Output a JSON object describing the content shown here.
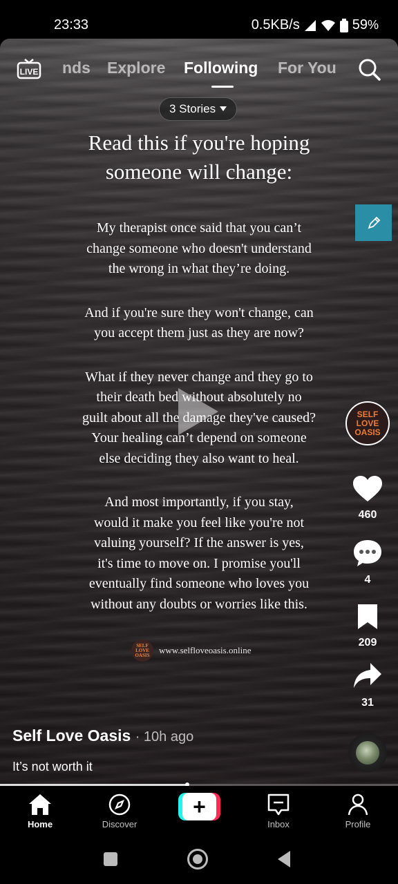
{
  "status": {
    "time": "23:33",
    "net": "0.5KB/s",
    "battery": "59"
  },
  "topnav": {
    "live": "LIVE",
    "tabs": [
      "nds",
      "Explore",
      "Following",
      "For You"
    ],
    "active_tab": "Following"
  },
  "stories_label": "3 Stories",
  "post": {
    "title_lines": [
      "Read this if you're hoping",
      "someone will change:"
    ],
    "paragraphs": [
      [
        "My therapist once said that you can’t",
        "change someone who doesn't understand",
        "the wrong in what they’re doing."
      ],
      [
        "And if you're sure they won't change, can",
        "you accept them just as they are now?"
      ],
      [
        "What if they never change and they go to",
        "their death bed without absolutely no",
        "guilt about all the damage they've caused?",
        "Your healing can’t depend on someone",
        "else deciding they also want to heal."
      ],
      [
        "And most importantly, if you stay,",
        "would it make you feel like you're not",
        "valuing yourself? If the answer is yes,",
        "it's time to move on. I promise you'll",
        "eventually find someone who loves you",
        "without any doubts or worries like this."
      ]
    ],
    "watermark_logo": "SELF LOVE OASIS",
    "watermark_url": "www.selfloveoasis.online"
  },
  "rail": {
    "avatar_text": [
      "SELF",
      "LOVE",
      "OASIS"
    ],
    "likes": "460",
    "comments": "4",
    "saves": "209",
    "shares": "31"
  },
  "caption": {
    "author": "Self Love Oasis",
    "ago": "· 10h ago",
    "description": "It’s not worth it"
  },
  "progress": 0.47,
  "bottomnav": {
    "home": "Home",
    "discover": "Discover",
    "plus": "+",
    "inbox": "Inbox",
    "profile": "Profile"
  },
  "colors": {
    "edit_button": "#2a8fa6",
    "avatar_text": "#ee7d35",
    "plus_left": "#25f4ee",
    "plus_right": "#fe2c55"
  }
}
